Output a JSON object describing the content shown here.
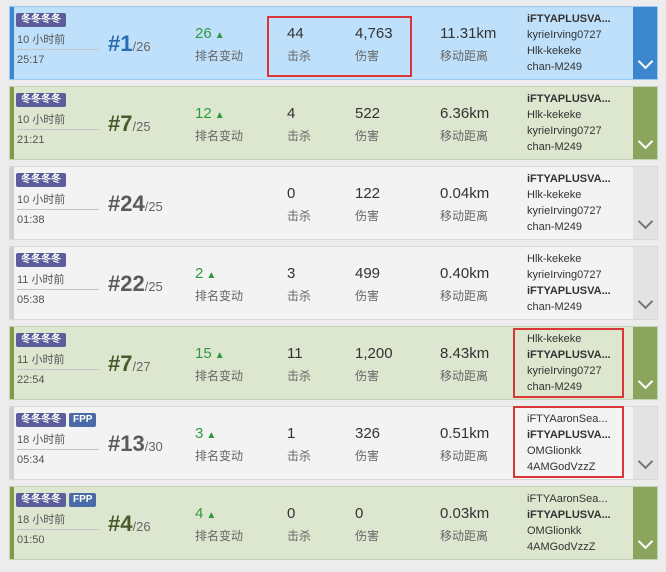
{
  "labels": {
    "rank_change": "排名变动",
    "kills": "击杀",
    "damage": "伤害",
    "distance": "移动距离"
  },
  "matches": [
    {
      "mode": "冬冬冬冬",
      "fpp": "",
      "time_ago": "10 小时前",
      "duration": "25:17",
      "rank": "#1",
      "total": "/26",
      "change": "26",
      "kills": "44",
      "damage": "4,763",
      "distance": "11.31km",
      "players": [
        "iFTYAPLUSVA...",
        "kyrieIrving0727",
        "Hlk-kekeke",
        "chan-M249"
      ],
      "me": 0,
      "style": "win"
    },
    {
      "mode": "冬冬冬冬",
      "fpp": "",
      "time_ago": "10 小时前",
      "duration": "21:21",
      "rank": "#7",
      "total": "/25",
      "change": "12",
      "kills": "4",
      "damage": "522",
      "distance": "6.36km",
      "players": [
        "iFTYAPLUSVA...",
        "Hlk-kekeke",
        "kyrieIrving0727",
        "chan-M249"
      ],
      "me": 0,
      "style": "top"
    },
    {
      "mode": "冬冬冬冬",
      "fpp": "",
      "time_ago": "10 小时前",
      "duration": "01:38",
      "rank": "#24",
      "total": "/25",
      "change": "",
      "kills": "0",
      "damage": "122",
      "distance": "0.04km",
      "players": [
        "iFTYAPLUSVA...",
        "Hlk-kekeke",
        "kyrieIrving0727",
        "chan-M249"
      ],
      "me": 0,
      "style": "other"
    },
    {
      "mode": "冬冬冬冬",
      "fpp": "",
      "time_ago": "11 小时前",
      "duration": "05:38",
      "rank": "#22",
      "total": "/25",
      "change": "2",
      "kills": "3",
      "damage": "499",
      "distance": "0.40km",
      "players": [
        "Hlk-kekeke",
        "kyrieIrving0727",
        "iFTYAPLUSVA...",
        "chan-M249"
      ],
      "me": 2,
      "style": "other"
    },
    {
      "mode": "冬冬冬冬",
      "fpp": "",
      "time_ago": "11 小时前",
      "duration": "22:54",
      "rank": "#7",
      "total": "/27",
      "change": "15",
      "kills": "11",
      "damage": "1,200",
      "distance": "8.43km",
      "players": [
        "Hlk-kekeke",
        "iFTYAPLUSVA...",
        "kyrieIrving0727",
        "chan-M249"
      ],
      "me": 1,
      "style": "top"
    },
    {
      "mode": "冬冬冬冬",
      "fpp": "FPP",
      "time_ago": "18 小时前",
      "duration": "05:34",
      "rank": "#13",
      "total": "/30",
      "change": "3",
      "kills": "1",
      "damage": "326",
      "distance": "0.51km",
      "players": [
        "iFTYAaronSea...",
        "iFTYAPLUSVA...",
        "OMGlionkk",
        "4AMGodVzzZ"
      ],
      "me": 1,
      "style": "other"
    },
    {
      "mode": "冬冬冬冬",
      "fpp": "FPP",
      "time_ago": "18 小时前",
      "duration": "01:50",
      "rank": "#4",
      "total": "/26",
      "change": "4",
      "kills": "0",
      "damage": "0",
      "distance": "0.03km",
      "players": [
        "iFTYAaronSea...",
        "iFTYAPLUSVA...",
        "OMGlionkk",
        "4AMGodVzzZ"
      ],
      "me": 1,
      "style": "top"
    }
  ]
}
